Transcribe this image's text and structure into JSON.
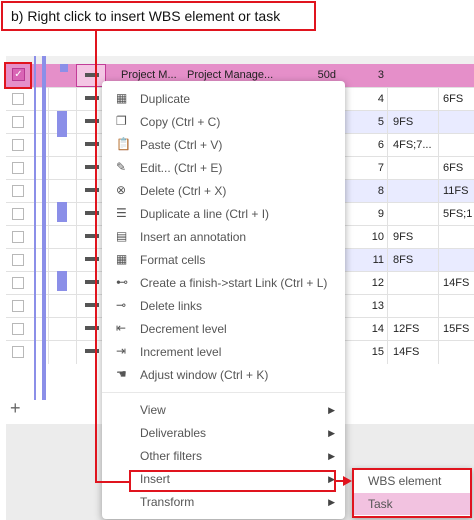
{
  "annotation": "b) Right click to insert WBS element or task",
  "selected_row": {
    "cells": [
      "Project M...",
      "Project Manage...",
      "50d",
      "3"
    ]
  },
  "rows": [
    {
      "num": "3",
      "pred": "",
      "succ": ""
    },
    {
      "num": "4",
      "pred": "",
      "succ": "6FS"
    },
    {
      "num": "5",
      "pred": "9FS",
      "succ": ""
    },
    {
      "num": "6",
      "pred": "4FS;7...",
      "succ": ""
    },
    {
      "num": "7",
      "pred": "",
      "succ": "6FS"
    },
    {
      "num": "8",
      "pred": "",
      "succ": "11FS"
    },
    {
      "num": "9",
      "pred": "",
      "succ": "5FS;1"
    },
    {
      "num": "10",
      "pred": "9FS",
      "succ": ""
    },
    {
      "num": "11",
      "pred": "8FS",
      "succ": ""
    },
    {
      "num": "12",
      "pred": "",
      "succ": "14FS"
    },
    {
      "num": "13",
      "pred": "",
      "succ": ""
    },
    {
      "num": "14",
      "pred": "12FS",
      "succ": "15FS"
    },
    {
      "num": "15",
      "pred": "14FS",
      "succ": ""
    }
  ],
  "add_row": "+",
  "menu": {
    "items": [
      {
        "label": "Duplicate",
        "icon": "duplicate-icon"
      },
      {
        "label": "Copy (Ctrl + C)",
        "icon": "copy-icon"
      },
      {
        "label": "Paste (Ctrl + V)",
        "icon": "paste-icon"
      },
      {
        "label": "Edit... (Ctrl + E)",
        "icon": "edit-icon"
      },
      {
        "label": "Delete (Ctrl + X)",
        "icon": "delete-icon"
      },
      {
        "label": "Duplicate a line (Ctrl + I)",
        "icon": "duplicate-line-icon"
      },
      {
        "label": "Insert an annotation",
        "icon": "annotation-icon"
      },
      {
        "label": "Format cells",
        "icon": "format-cells-icon"
      },
      {
        "label": "Create a finish->start Link (Ctrl + L)",
        "icon": "link-icon"
      },
      {
        "label": "Delete links",
        "icon": "unlink-icon"
      },
      {
        "label": "Decrement level",
        "icon": "outdent-icon"
      },
      {
        "label": "Increment level",
        "icon": "indent-icon"
      },
      {
        "label": "Adjust window (Ctrl + K)",
        "icon": "adjust-window-icon"
      }
    ],
    "submenus": [
      {
        "label": "View",
        "arrow": "▶"
      },
      {
        "label": "Deliverables",
        "arrow": "▶"
      },
      {
        "label": "Other filters",
        "arrow": "▶"
      },
      {
        "label": "Insert",
        "arrow": "▶"
      },
      {
        "label": "Transform",
        "arrow": "▶"
      }
    ]
  },
  "insert_submenu": [
    "WBS element",
    "Task"
  ],
  "colors": {
    "selected_row": "#e58fc9",
    "highlight": "#e0141e",
    "task_highlight": "#f2c2e0",
    "tree_bar": "#8b8fe8"
  }
}
